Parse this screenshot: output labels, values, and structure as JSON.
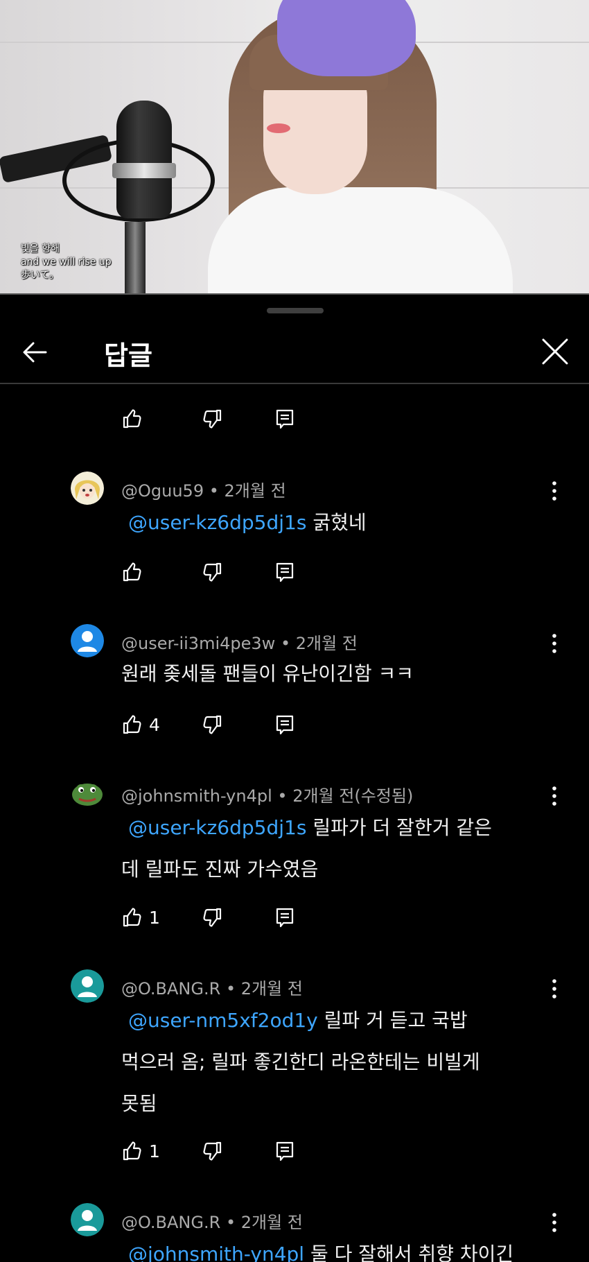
{
  "video": {
    "subtitle_lines": [
      "빛을 향해",
      "and we will rise up",
      "歩いて。"
    ]
  },
  "header": {
    "title": "답글"
  },
  "colors": {
    "background": "#000000",
    "mention": "#3ea6ff",
    "meta": "#aaaaaa",
    "text": "#f1f1f1"
  },
  "top_actions": {
    "like_count": ""
  },
  "comments": [
    {
      "author": "@Oguu59",
      "sep": "•",
      "time": "2개월 전",
      "mention": "@user-kz6dp5dj1s",
      "text": " 굵혔네",
      "line2": "",
      "line3": "",
      "likes": "",
      "avatar_type": "anime-avatar"
    },
    {
      "author": "@user-ii3mi4pe3w",
      "sep": "•",
      "time": "2개월 전",
      "mention": "",
      "text": "원래 좆세돌 팬들이 유난이긴함 ㅋㅋ",
      "line2": "",
      "line3": "",
      "likes": "4",
      "avatar_type": "default-avatar"
    },
    {
      "author": "@johnsmith-yn4pl",
      "sep": "•",
      "time": "2개월 전(수정됨)",
      "mention": "@user-kz6dp5dj1s",
      "text": "  릴파가 더 잘한거 같은",
      "line2": "데 릴파도 진짜 가수였음",
      "line3": "",
      "likes": "1",
      "avatar_type": "frog-avatar"
    },
    {
      "author": "@O.BANG.R",
      "sep": "•",
      "time": "2개월 전",
      "mention": "@user-nm5xf2od1y",
      "text": " 릴파 거 듣고 국밥",
      "line2": "먹으러 옴; 릴파 좋긴한디 라온한테는 비빌게",
      "line3": "못됨",
      "likes": "1",
      "avatar_type": "default-avatar-teal"
    },
    {
      "author": "@O.BANG.R",
      "sep": "•",
      "time": "2개월 전",
      "mention": "@johnsmith-yn4pl",
      "text": " 둘 다 잘해서 취향 차이긴",
      "line2": "",
      "line3": "",
      "likes": "",
      "avatar_type": "default-avatar-teal"
    }
  ]
}
